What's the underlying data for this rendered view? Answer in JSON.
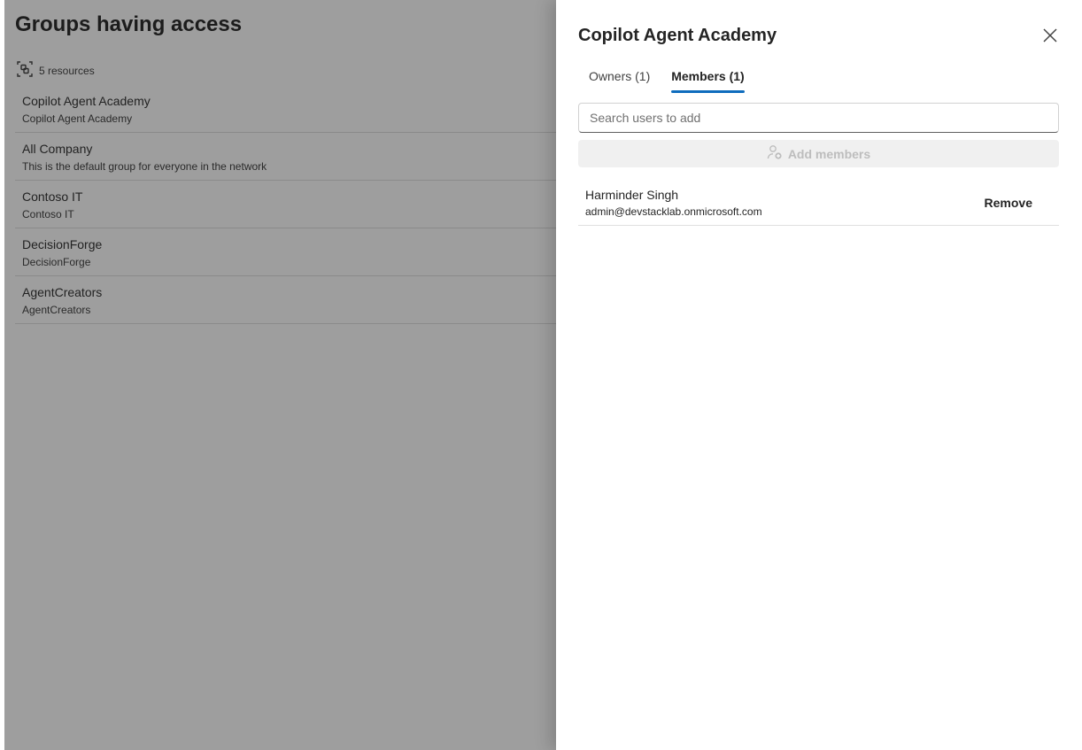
{
  "background": {
    "title": "Groups having access",
    "resource_count_label": "5 resources",
    "resources": [
      {
        "name": "Copilot Agent Academy",
        "description": "Copilot Agent Academy"
      },
      {
        "name": "All Company",
        "description": "This is the default group for everyone in the network"
      },
      {
        "name": "Contoso IT",
        "description": "Contoso IT"
      },
      {
        "name": "DecisionForge",
        "description": "DecisionForge"
      },
      {
        "name": "AgentCreators",
        "description": "AgentCreators"
      }
    ]
  },
  "panel": {
    "title": "Copilot Agent Academy",
    "tabs": [
      {
        "label": "Owners (1)",
        "active": false
      },
      {
        "label": "Members (1)",
        "active": true
      }
    ],
    "search": {
      "placeholder": "Search users to add",
      "value": ""
    },
    "add_button_label": "Add members",
    "members": [
      {
        "name": "Harminder Singh",
        "email": "admin@devstacklab.onmicrosoft.com",
        "action_label": "Remove"
      }
    ]
  },
  "colors": {
    "accent": "#0f6cbd",
    "overlay": "#9e9e9e"
  },
  "icons": {
    "resources": "resource-group-icon",
    "close": "close-icon",
    "add_member": "person-add-icon"
  }
}
